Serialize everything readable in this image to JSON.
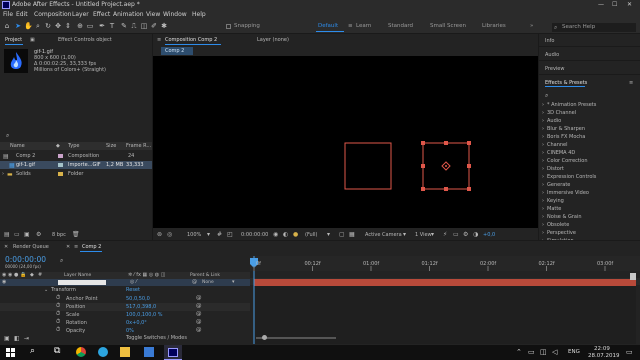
{
  "window": {
    "title": "Adobe After Effects - Untitled Project.aep *"
  },
  "menu": [
    "File",
    "Edit",
    "Composition",
    "Layer",
    "Effect",
    "Animation",
    "View",
    "Window",
    "Help"
  ],
  "toolbar": {
    "snapping_label": "Snapping",
    "workspaces": [
      "Default",
      "Learn",
      "Standard",
      "Small Screen",
      "Libraries"
    ],
    "active_workspace": "Default",
    "search_placeholder": "Search Help"
  },
  "project": {
    "tab_project": "Project",
    "tab_effect_controls": "Effect Controls object",
    "item_name": "gif-1.gif",
    "item_info": [
      "800 x 600 (1,00)",
      "Δ 0:00:02:25, 33,333 fps",
      "Millions of Colors+ (Straight)"
    ],
    "columns": [
      "Name",
      "Type",
      "Size",
      "Frame R..."
    ],
    "rows": [
      {
        "name": "Comp 2",
        "type": "Composition",
        "size": "",
        "fps": "24",
        "icon": "composition-icon"
      },
      {
        "name": "gif-1.gif",
        "type": "Importe...GIF",
        "size": "1,2 MB",
        "fps": "33,333",
        "icon": "footage-icon"
      },
      {
        "name": "Solids",
        "type": "Folder",
        "size": "",
        "fps": "",
        "icon": "folder-icon"
      }
    ],
    "bpc": "8 bpc"
  },
  "viewer": {
    "tab_composition": "Composition Comp 2",
    "tab_layer": "Layer (none)",
    "comp_tab": "Comp 2",
    "zoom": "100%",
    "timecode": "0:00:00:00",
    "resolution": "(Full)",
    "camera": "Active Camera",
    "views": "1 View",
    "exposure": "+0,0"
  },
  "right_panel": {
    "sections": [
      "Info",
      "Audio",
      "Preview",
      "Effects & Presets"
    ],
    "effects": [
      "* Animation Presets",
      "3D Channel",
      "Audio",
      "Blur & Sharpen",
      "Boris FX Mocha",
      "Channel",
      "CINEMA 4D",
      "Color Correction",
      "Distort",
      "Expression Controls",
      "Generate",
      "Immersive Video",
      "Keying",
      "Matte",
      "Noise & Grain",
      "Obsolete",
      "Perspective",
      "Simulation"
    ]
  },
  "timeline": {
    "tab_render_queue": "Render Queue",
    "tab_comp": "Comp 2",
    "timecode": "0:00:00:00",
    "timecode_sub": "00000 (24,00 fps)",
    "header_layer_name": "Layer Name",
    "header_parent": "Parent & Link",
    "parent_value": "None",
    "transform_label": "Transform",
    "reset_label": "Reset",
    "properties": [
      {
        "name": "Anchor Point",
        "value": "50,0,50,0"
      },
      {
        "name": "Position",
        "value": "517,0,398,0"
      },
      {
        "name": "Scale",
        "value": "100,0,100,0 %"
      },
      {
        "name": "Rotation",
        "value": "0x+0,0°"
      },
      {
        "name": "Opacity",
        "value": "0%"
      }
    ],
    "ruler": [
      "0f",
      "00:12f",
      "01:00f",
      "01:12f",
      "02:00f",
      "02:12f",
      "03:00f"
    ],
    "footer": "Toggle Switches / Modes"
  },
  "taskbar": {
    "language": "ENG",
    "time": "22:09",
    "date": "28.07.2019"
  },
  "colors": {
    "accent": "#2d8ceb",
    "shape_stroke": "#e0574a",
    "layer_bar": "#b84a3a",
    "bg": "#232323"
  }
}
